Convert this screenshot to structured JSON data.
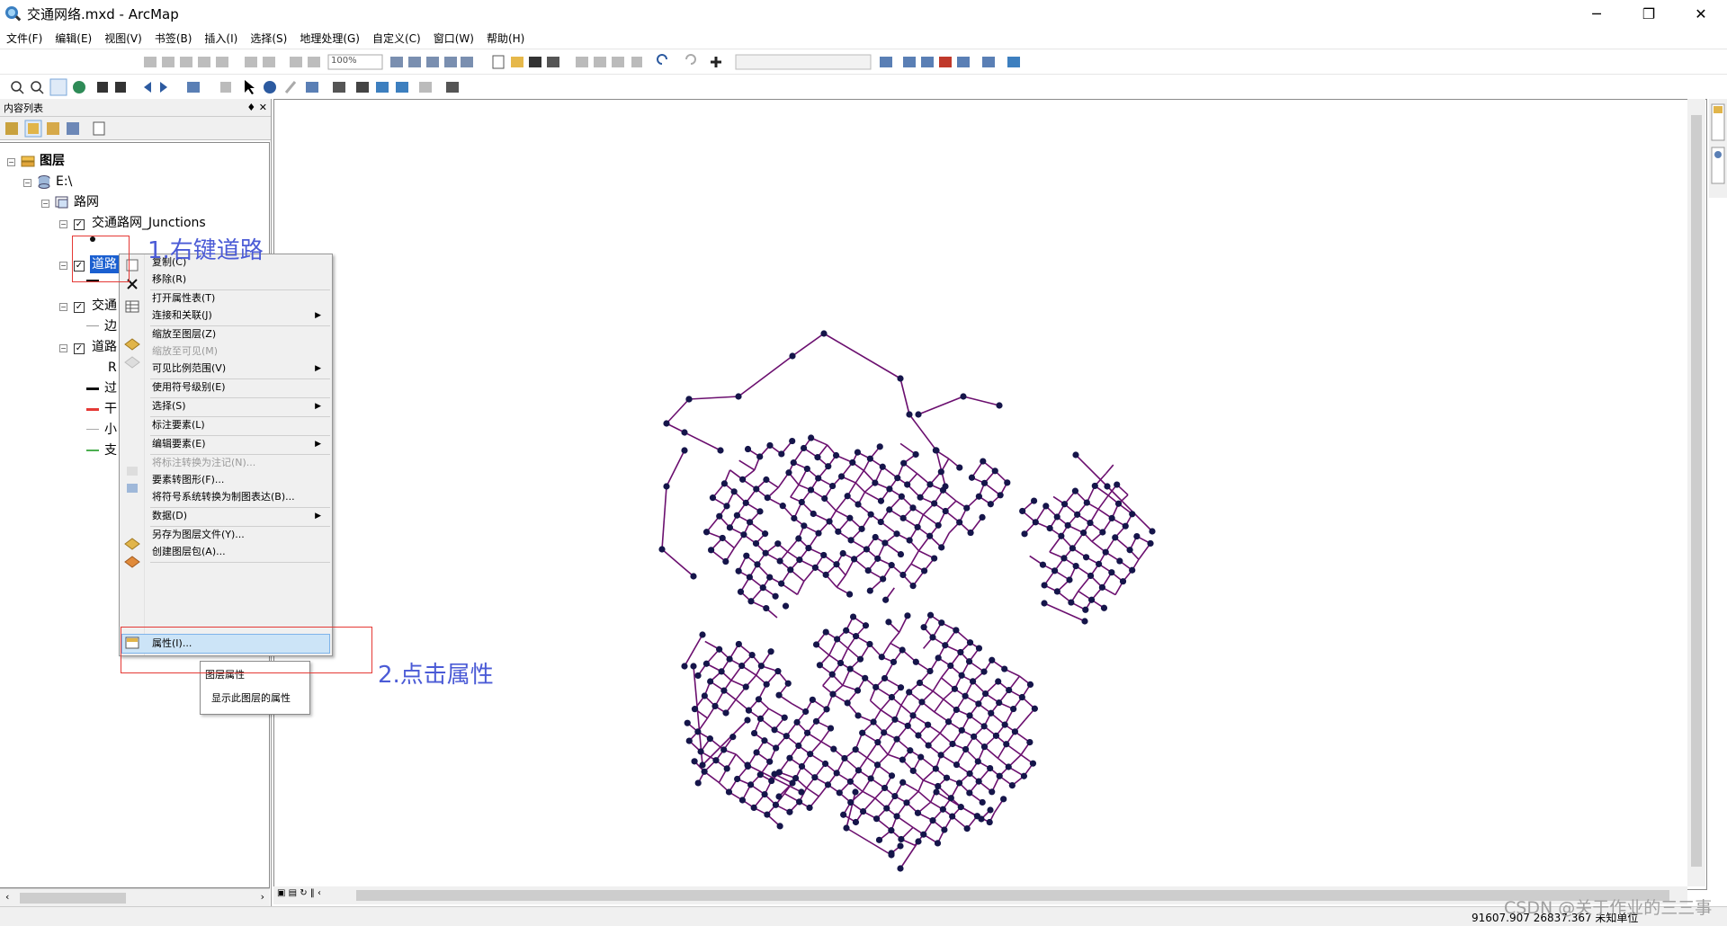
{
  "window": {
    "title": "交通网络.mxd - ArcMap",
    "minimize": "─",
    "restore": "❐",
    "close": "✕"
  },
  "menus": [
    "文件(F)",
    "编辑(E)",
    "视图(V)",
    "书签(B)",
    "插入(I)",
    "选择(S)",
    "地理处理(G)",
    "自定义(C)",
    "窗口(W)",
    "帮助(H)"
  ],
  "toolbar": {
    "zoom_value": "100%"
  },
  "toc": {
    "title": "内容列表",
    "pin": "♦ ✕",
    "tree": {
      "root": "图层",
      "drive": "E:\\",
      "dataset": "路网",
      "layer_junctions": "交通路网_Junctions",
      "layer_road_selected": "道路",
      "layer_traffic": "交通",
      "legend_edge": "边",
      "layer_road2": "道路",
      "legend_r": "R",
      "legend_1": "过",
      "legend_2": "干",
      "legend_3": "小",
      "legend_4": "支"
    }
  },
  "context_menu": {
    "items": [
      {
        "label": "复制(C)",
        "icon": "copy-icon"
      },
      {
        "label": "移除(R)",
        "icon": "remove-icon"
      },
      {
        "label": "打开属性表(T)",
        "icon": "table-icon"
      },
      {
        "label": "连接和关联(J)",
        "submenu": true
      },
      {
        "label": "缩放至图层(Z)",
        "icon": "zoom-layer-icon"
      },
      {
        "label": "缩放至可见(M)",
        "disabled": true
      },
      {
        "label": "可见比例范围(V)",
        "submenu": true
      },
      {
        "label": "使用符号级别(E)"
      },
      {
        "label": "选择(S)",
        "submenu": true
      },
      {
        "label": "标注要素(L)"
      },
      {
        "label": "编辑要素(E)",
        "submenu": true
      },
      {
        "label": "将标注转换为注记(N)...",
        "disabled": true
      },
      {
        "label": "要素转图形(F)..."
      },
      {
        "label": "将符号系统转换为制图表达(B)..."
      },
      {
        "label": "数据(D)",
        "submenu": true
      },
      {
        "label": "另存为图层文件(Y)..."
      },
      {
        "label": "创建图层包(A)..."
      },
      {
        "label": "属性(I)...",
        "highlighted": true
      }
    ]
  },
  "tooltip": {
    "title": "图层属性",
    "desc": "显示此图层的属性"
  },
  "annotations": {
    "step1": "1.右键道路",
    "step2": "2.点击属性"
  },
  "status": {
    "coords": "91607.907  26837.367 未知单位"
  },
  "watermark": "CSDN @关于作业的三三事",
  "colors": {
    "road_line": "#6b0f6f",
    "junction_point": "#15154a",
    "annotation": "#4b5bd6",
    "highlight_box": "#e53935"
  }
}
